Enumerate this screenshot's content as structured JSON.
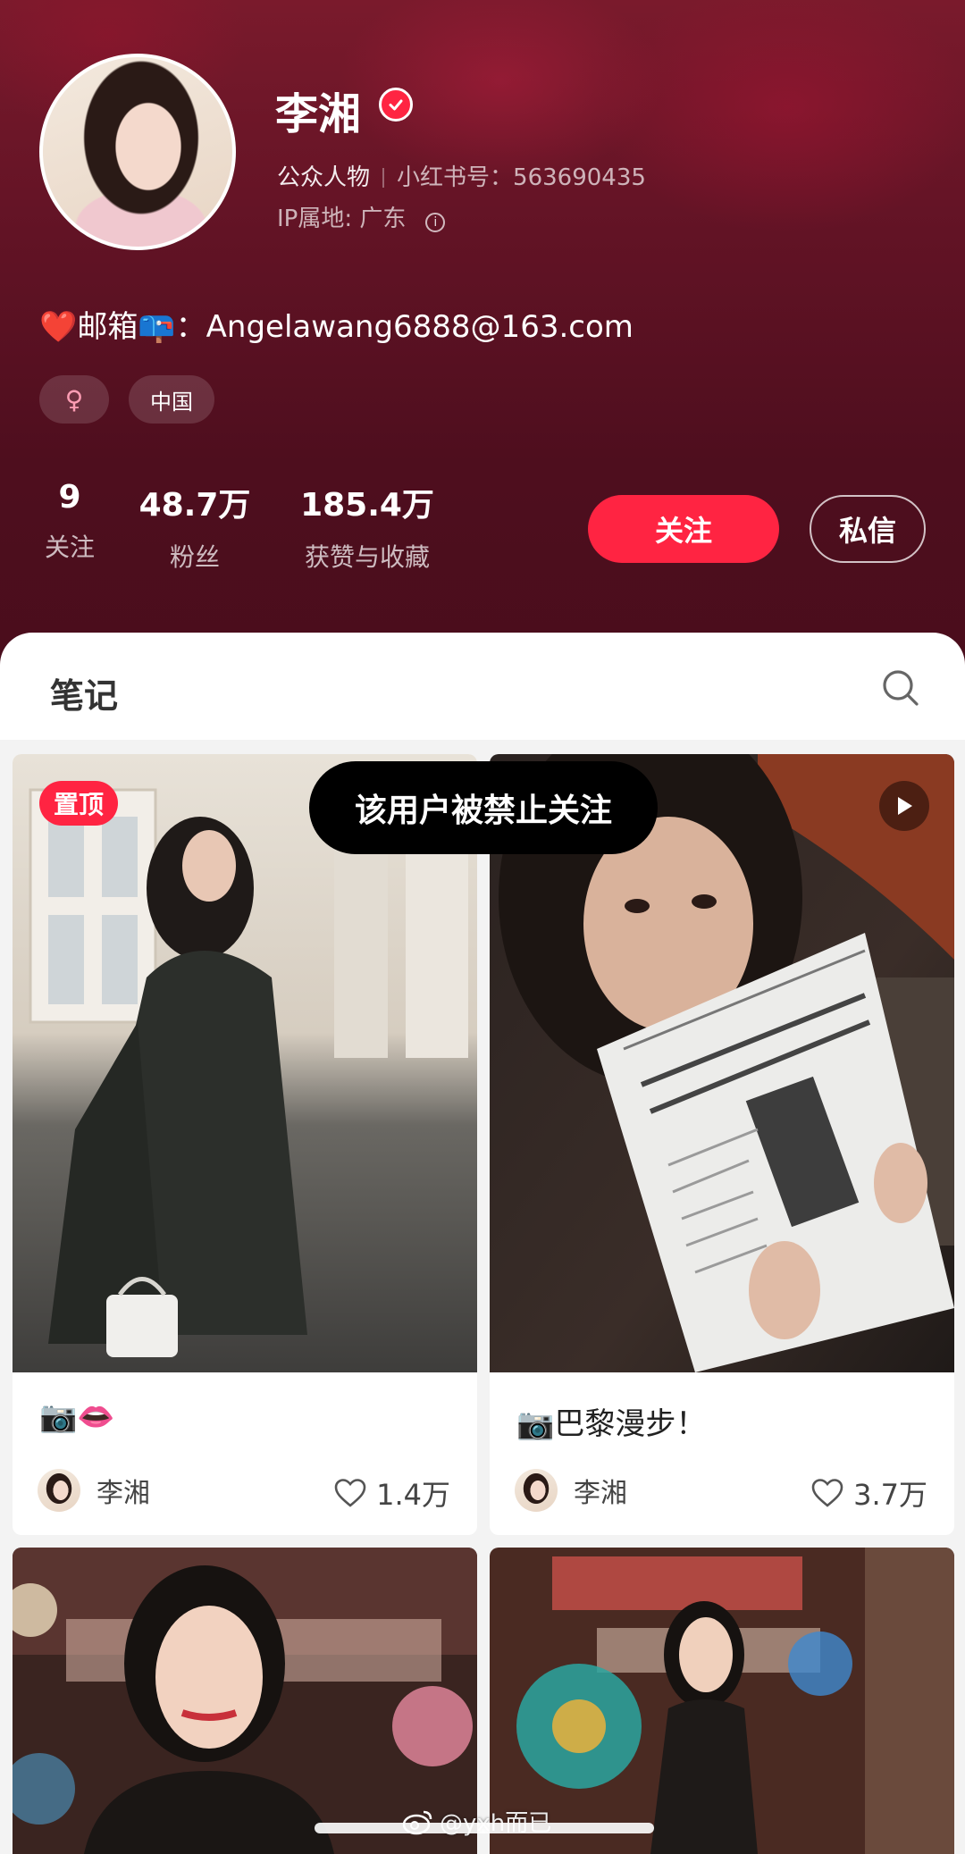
{
  "profile": {
    "name": "李湘",
    "role": "公众人物",
    "id_label": "小红书号：",
    "id_value": "563690435",
    "ip_label": "IP属地: 广东",
    "bio": "❤️邮箱📪：Angelawang6888@163.com",
    "tags": [
      "♀",
      "中国"
    ]
  },
  "stats": [
    {
      "value": "9",
      "label": "关注"
    },
    {
      "value": "48.7万",
      "label": "粉丝"
    },
    {
      "value": "185.4万",
      "label": "获赞与收藏"
    }
  ],
  "actions": {
    "follow": "关注",
    "message": "私信"
  },
  "tabs": {
    "notes": "笔记"
  },
  "toast": "该用户被禁止关注",
  "notes": [
    {
      "pinned_label": "置顶",
      "title": "📷👄",
      "author": "李湘",
      "likes": "1.4万"
    },
    {
      "title": "📷巴黎漫步！",
      "author": "李湘",
      "likes": "3.7万"
    },
    {},
    {}
  ],
  "watermark": "@yxh而已",
  "colors": {
    "accent": "#ff2442",
    "header_bg": "#5a1022"
  }
}
